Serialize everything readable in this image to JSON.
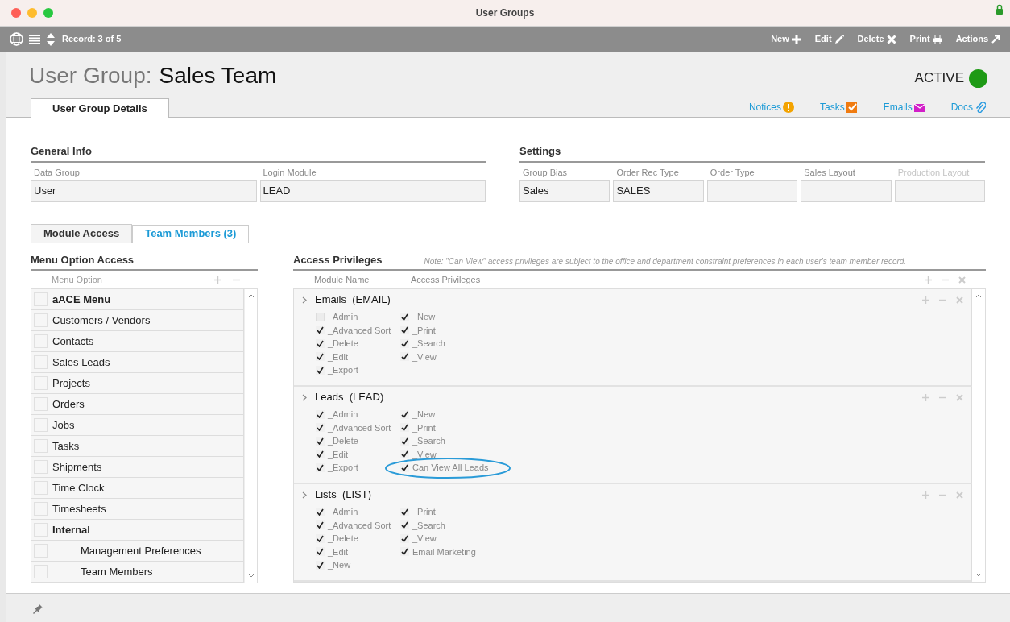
{
  "window": {
    "title": "User Groups"
  },
  "toolbar": {
    "record": "Record: 3 of 5",
    "actions": [
      "New",
      "Edit",
      "Delete",
      "Print",
      "Actions"
    ]
  },
  "header": {
    "prefix": "User Group:",
    "name": "Sales Team",
    "status": {
      "label": "ACTIVE",
      "active": true
    }
  },
  "tabs": [
    {
      "label": "User Group Details",
      "selected": true
    }
  ],
  "links": [
    "Notices",
    "Tasks",
    "Emails",
    "Docs"
  ],
  "general_info": {
    "title": "General Info",
    "fields": [
      {
        "label": "Data Group",
        "value": "User",
        "disabled": false
      },
      {
        "label": "Login Module",
        "value": "LEAD",
        "disabled": false
      }
    ]
  },
  "settings": {
    "title": "Settings",
    "fields": [
      {
        "label": "Group Bias",
        "value": "Sales",
        "disabled": false
      },
      {
        "label": "Order Rec Type",
        "value": "SALES",
        "disabled": false
      },
      {
        "label": "Order Type",
        "disabled": false
      },
      {
        "label": "Sales Layout",
        "disabled": false
      },
      {
        "label": "Production Layout",
        "disabled": true
      }
    ]
  },
  "module_tabs": [
    {
      "label": "Module Access",
      "selected": true
    },
    {
      "label": "Team Members (3)",
      "selected": false
    }
  ],
  "menu_option_access": {
    "title": "Menu Option Access",
    "column": "Menu Option",
    "items": [
      {
        "label": "aACE Menu",
        "kind": "heading",
        "checked": false
      },
      {
        "label": "Customers / Vendors",
        "kind": "item",
        "checked": false
      },
      {
        "label": "Contacts",
        "kind": "item",
        "checked": false
      },
      {
        "label": "Sales Leads",
        "kind": "item",
        "checked": false
      },
      {
        "label": "Projects",
        "kind": "item",
        "checked": false
      },
      {
        "label": "Orders",
        "kind": "item",
        "checked": false
      },
      {
        "label": "Jobs",
        "kind": "item",
        "checked": false
      },
      {
        "label": "Tasks",
        "kind": "item",
        "checked": false
      },
      {
        "label": "Shipments",
        "kind": "item",
        "checked": false
      },
      {
        "label": "Time Clock",
        "kind": "item",
        "checked": false
      },
      {
        "label": "Timesheets",
        "kind": "item",
        "checked": false
      },
      {
        "label": "Internal",
        "kind": "heading",
        "checked": false,
        "children": [
          {
            "label": "Management Preferences",
            "checked": false
          },
          {
            "label": "Team Members",
            "checked": false
          }
        ]
      }
    ]
  },
  "access_privileges": {
    "title": "Access Privileges",
    "note": "Note: \"Can View\" access privileges are subject to the office and department constraint preferences in each user's team member record.",
    "columns": [
      "Module Name",
      "Access Privileges"
    ],
    "modules": [
      {
        "name": "Emails  (EMAIL)",
        "privileges": [
          [
            {
              "label": "_Admin",
              "checked": false
            },
            {
              "label": "_Advanced Sort",
              "checked": true
            },
            {
              "label": "_Delete",
              "checked": true
            },
            {
              "label": "_Edit",
              "checked": true
            },
            {
              "label": "_Export",
              "checked": true
            }
          ],
          [
            {
              "label": "_New",
              "checked": true
            },
            {
              "label": "_Print",
              "checked": true
            },
            {
              "label": "_Search",
              "checked": true
            },
            {
              "label": "_View",
              "checked": true
            }
          ]
        ]
      },
      {
        "name": "Leads  (LEAD)",
        "privileges": [
          [
            {
              "label": "_Admin",
              "checked": true
            },
            {
              "label": "_Advanced Sort",
              "checked": true
            },
            {
              "label": "_Delete",
              "checked": true
            },
            {
              "label": "_Edit",
              "checked": true
            },
            {
              "label": "_Export",
              "checked": true
            }
          ],
          [
            {
              "label": "_New",
              "checked": true
            },
            {
              "label": "_Print",
              "checked": true
            },
            {
              "label": "_Search",
              "checked": true
            },
            {
              "label": "_View",
              "checked": true
            },
            {
              "label": "Can View All Leads",
              "checked": true,
              "highlighted": true
            }
          ]
        ]
      },
      {
        "name": "Lists  (LIST)",
        "privileges": [
          [
            {
              "label": "_Admin",
              "checked": true
            },
            {
              "label": "_Advanced Sort",
              "checked": true
            },
            {
              "label": "_Delete",
              "checked": true
            },
            {
              "label": "_Edit",
              "checked": true
            },
            {
              "label": "_New",
              "checked": true
            }
          ],
          [
            {
              "label": "_Print",
              "checked": true
            },
            {
              "label": "_Search",
              "checked": true
            },
            {
              "label": "_View",
              "checked": true
            },
            {
              "label": "Email Marketing",
              "checked": true
            }
          ]
        ]
      }
    ]
  }
}
